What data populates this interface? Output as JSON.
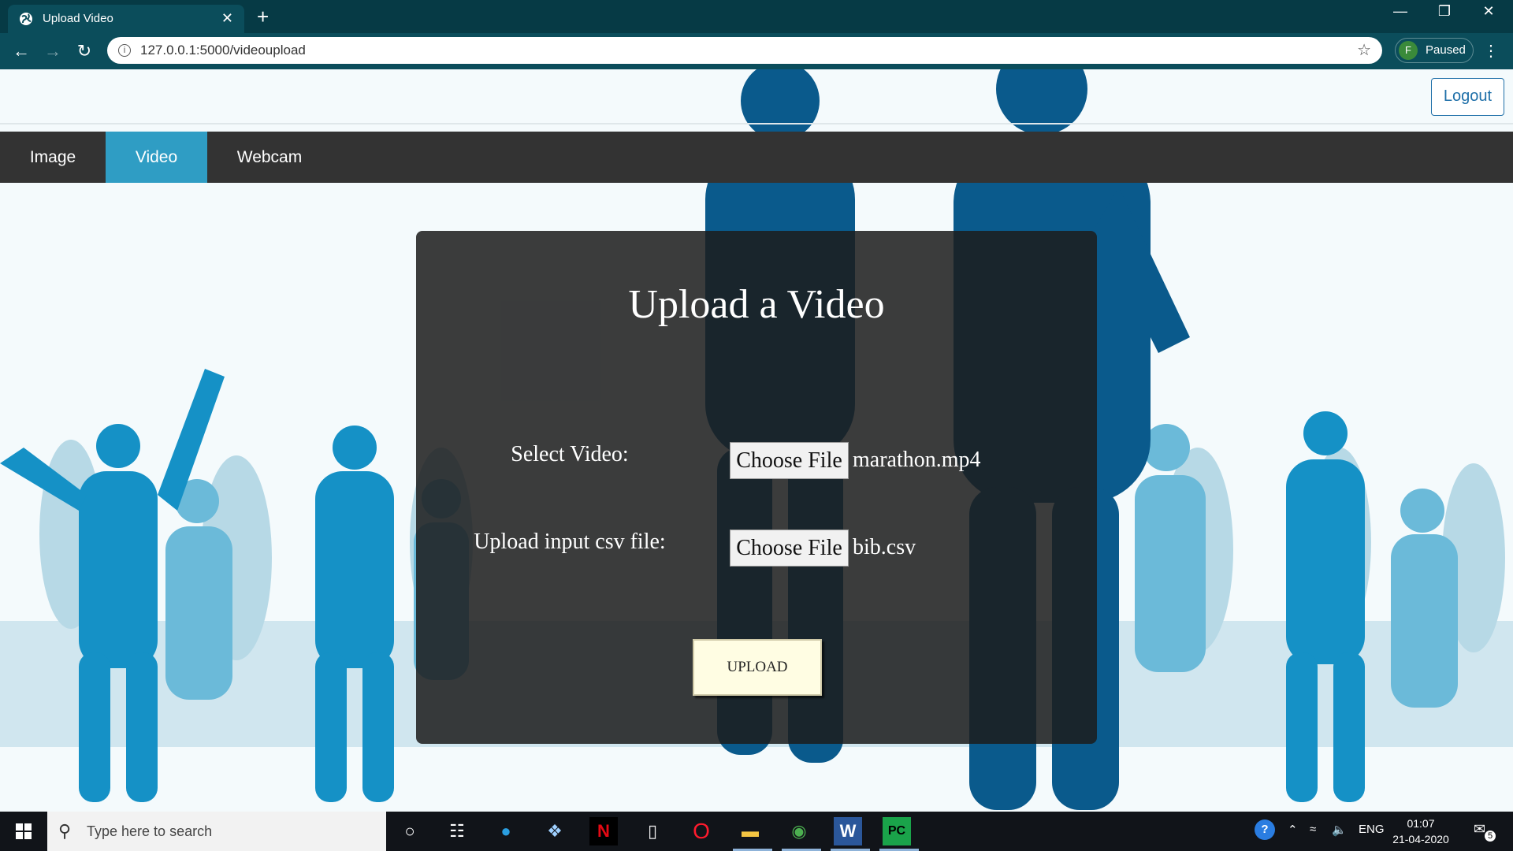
{
  "browser": {
    "tab_title": "Upload Video",
    "tab_close": "✕",
    "new_tab": "+",
    "url": "127.0.0.1:5000/videoupload",
    "profile_initial": "F",
    "profile_status": "Paused"
  },
  "header": {
    "logout_label": "Logout"
  },
  "nav": {
    "items": [
      {
        "label": "Image"
      },
      {
        "label": "Video"
      },
      {
        "label": "Webcam"
      }
    ],
    "active": "Video"
  },
  "form": {
    "title": "Upload a Video",
    "video_label": "Select Video:",
    "video_button": "Choose File",
    "video_file": "marathon.mp4",
    "csv_label": "Upload input csv file:",
    "csv_button": "Choose File",
    "csv_file": "bib.csv",
    "submit_label": "UPLOAD"
  },
  "taskbar": {
    "search_placeholder": "Type here to search",
    "language": "ENG",
    "time": "01:07",
    "date": "21-04-2020",
    "notification_count": "5"
  },
  "colors": {
    "nav_active": "#2f9dc4",
    "nav_bg": "#333333",
    "card_bg": "#1c1c1c",
    "browser_chrome": "#0b4d5b"
  }
}
